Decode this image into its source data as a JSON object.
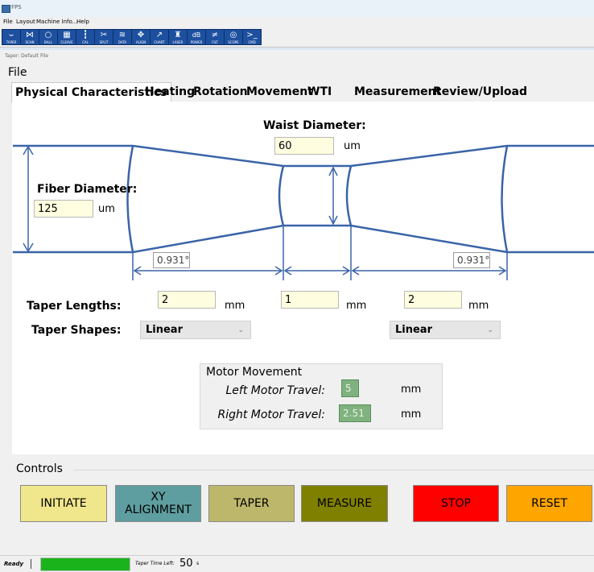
{
  "window": {
    "title": "FPS"
  },
  "menubar": {
    "items": [
      "File",
      "Layout",
      "Machine Info...",
      "Help"
    ]
  },
  "toolbar": {
    "buttons": [
      {
        "icon": "taper-icon",
        "label": "TAPER"
      },
      {
        "icon": "scan-icon",
        "label": "SCAN"
      },
      {
        "icon": "ball-icon",
        "label": "BALL"
      },
      {
        "icon": "cleave-icon",
        "label": "CLEAVE"
      },
      {
        "icon": "cal-icon",
        "label": "CAL"
      },
      {
        "icon": "split-icon",
        "label": "SPLIT"
      },
      {
        "icon": "data-icon",
        "label": "DATA"
      },
      {
        "icon": "align-icon",
        "label": "ALIGN"
      },
      {
        "icon": "chart-icon",
        "label": "CHART"
      },
      {
        "icon": "laser-icon",
        "label": "LASER"
      },
      {
        "icon": "db-icon",
        "label": "POWER"
      },
      {
        "icon": "filter-icon",
        "label": "FILT"
      },
      {
        "icon": "scope-icon",
        "label": "SCOPE"
      },
      {
        "icon": "cmd-icon",
        "label": "CMD"
      }
    ]
  },
  "subwindow": {
    "caption": "Taper: Default File",
    "menu": "File"
  },
  "tabs": [
    "Physical Characteristics",
    "Heating",
    "Rotation",
    "Movement",
    "WTI",
    "Measurement",
    "Review/Upload"
  ],
  "physical": {
    "waist_label": "Waist Diameter:",
    "waist_value": "60",
    "waist_unit": "um",
    "fiber_label": "Fiber Diameter:",
    "fiber_value": "125",
    "fiber_unit": "um",
    "angle_left": "0.931°",
    "angle_right": "0.931°",
    "taper_lengths_label": "Taper Lengths:",
    "lengths": [
      {
        "value": "2",
        "unit": "mm"
      },
      {
        "value": "1",
        "unit": "mm"
      },
      {
        "value": "2",
        "unit": "mm"
      }
    ],
    "taper_shapes_label": "Taper Shapes:",
    "shape_left": "Linear",
    "shape_right": "Linear"
  },
  "motor": {
    "title": "Motor Movement",
    "left_label": "Left Motor Travel:",
    "left_value": "5",
    "left_unit": "mm",
    "right_label": "Right Motor Travel:",
    "right_value": "2.51",
    "right_unit": "mm"
  },
  "controls": {
    "title": "Controls",
    "buttons": [
      {
        "label": "INITIATE",
        "color": "#f0e68c"
      },
      {
        "label": "XY ALIGNMENT",
        "color": "#5f9ea0"
      },
      {
        "label": "TAPER",
        "color": "#bdb76b"
      },
      {
        "label": "MEASURE",
        "color": "#808000"
      },
      {
        "label": "STOP",
        "color": "#ff0000"
      },
      {
        "label": "RESET",
        "color": "#ffa500"
      }
    ]
  },
  "status": {
    "state": "Ready",
    "progress": 1.0,
    "progress_color": "#1bb31b",
    "time_label": "Taper Time Left:",
    "time_value": "50",
    "time_unit": "s"
  },
  "colors": {
    "diagram": "#3a64a8"
  }
}
